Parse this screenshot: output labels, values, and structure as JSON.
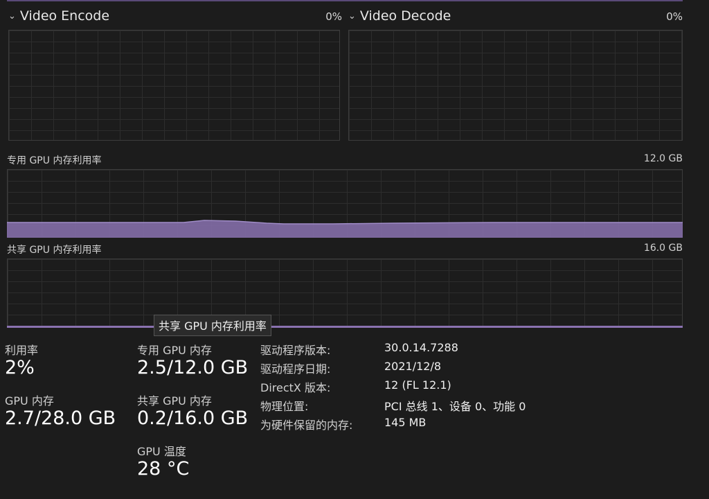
{
  "engines": [
    {
      "title": "Video Encode",
      "percent": "0%"
    },
    {
      "title": "Video Decode",
      "percent": "0%"
    }
  ],
  "memory_charts": [
    {
      "title": "专用 GPU 内存利用率",
      "max": "12.0 GB"
    },
    {
      "title": "共享 GPU 内存利用率",
      "max": "16.0 GB"
    }
  ],
  "tooltip": "共享 GPU 内存利用率",
  "stats": {
    "utilization": {
      "label": "利用率",
      "value": "2%"
    },
    "gpu_memory": {
      "label": "GPU 内存",
      "value": "2.7/28.0 GB"
    },
    "dedicated_memory": {
      "label": "专用 GPU 内存",
      "value": "2.5/12.0 GB"
    },
    "shared_memory": {
      "label": "共享 GPU 内存",
      "value": "0.2/16.0 GB"
    },
    "temperature": {
      "label": "GPU 温度",
      "value": "28 °C"
    }
  },
  "details": [
    {
      "key": "驱动程序版本:",
      "value": "30.0.14.7288"
    },
    {
      "key": "驱动程序日期:",
      "value": "2021/12/8"
    },
    {
      "key": "DirectX 版本:",
      "value": "12 (FL 12.1)"
    },
    {
      "key": "物理位置:",
      "value": "PCI 总线 1、设备 0、功能 0"
    },
    {
      "key": "为硬件保留的内存:",
      "value": "145 MB"
    }
  ],
  "colors": {
    "graph_fill": "#8a72b0",
    "graph_line": "#a08cc8",
    "background": "#1c1c1c"
  }
}
